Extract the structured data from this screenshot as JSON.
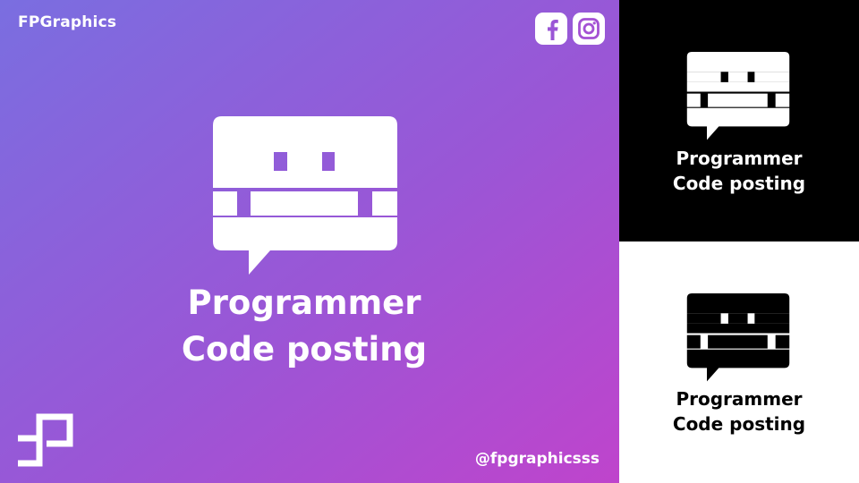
{
  "brand": {
    "name": "FPGraphics"
  },
  "social": {
    "facebook_icon": "facebook-icon",
    "instagram_icon": "instagram-icon"
  },
  "main": {
    "title_line1": "Programmer",
    "title_line2": "Code posting",
    "handle": "@fpgraphicsss",
    "logo_icon": "fp-monogram-icon",
    "icon": "code-posting-message-icon"
  },
  "variants": {
    "dark": {
      "title_line1": "Programmer",
      "title_line2": "Code posting",
      "background": "#000000",
      "foreground": "#ffffff"
    },
    "light": {
      "title_line1": "Programmer",
      "title_line2": "Code posting",
      "background": "#ffffff",
      "foreground": "#000000"
    }
  },
  "colors": {
    "gradient_start": "#7a6ee0",
    "gradient_mid": "#9a56d6",
    "gradient_end": "#bf44cc",
    "white": "#ffffff",
    "black": "#000000"
  }
}
